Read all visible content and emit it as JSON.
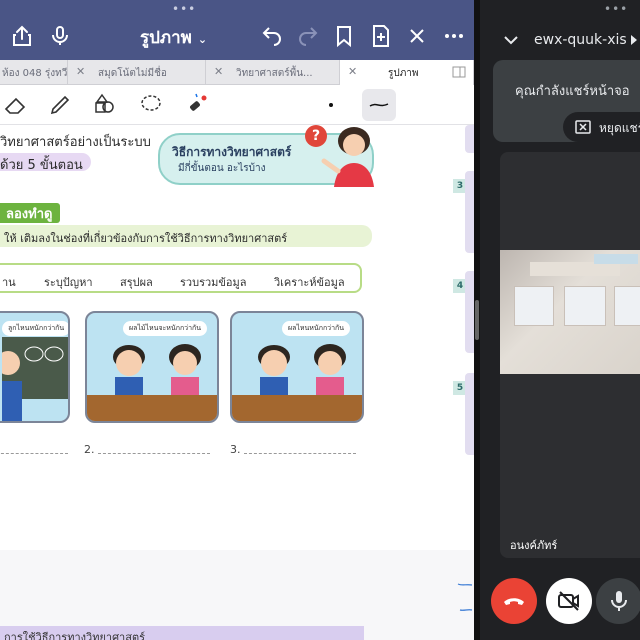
{
  "colors": {
    "titlebar": "#4a5586",
    "meet_bg": "#202124",
    "end_call": "#ea4335",
    "accent_green": "#6db33f"
  },
  "notes": {
    "title": "รูปภาพ",
    "toolbar_icons": [
      "share-icon",
      "microphone-icon",
      "undo-icon",
      "redo-icon",
      "bookmark-icon",
      "add-page-icon",
      "close-icon",
      "more-icon"
    ],
    "tabs": [
      {
        "label": "ห้อง 048 รุ่งทวี...",
        "active": false
      },
      {
        "label": "สมุดโน้ตไม่มีชื่อ",
        "active": false
      },
      {
        "label": "วิทยาศาสตร์พื้น...",
        "active": false
      },
      {
        "label": "รูปภาพ",
        "active": true
      }
    ],
    "tools": [
      "eraser-icon",
      "highlighter-icon",
      "shapes-icon",
      "lasso-icon",
      "laser-pointer-icon",
      "pen-dot-icon",
      "stroke-style-icon"
    ]
  },
  "page": {
    "line1": "วิทยาศาสตร์อย่างเป็นระบบ",
    "line2": "ด้วย 5 ขั้นตอน",
    "banner_title": "วิธีการทางวิทยาศาสตร์",
    "banner_sub": "มีกี่ขั้นตอน อะไรบ้าง",
    "banner_q": "?",
    "section_label": "ลองทำดู",
    "instruction": "ให้ เติมลงในช่องที่เกี่ยวข้องกับการใช้วิธีการทางวิทยาศาสตร์",
    "word_bank": [
      "าน",
      "ระบุปัญหา",
      "สรุปผล",
      "รวบรวมข้อมูล",
      "วิเคราะห์ข้อมูล"
    ],
    "panels": [
      {
        "bubble": "ลูกไหนหนักกว่ากัน"
      },
      {
        "bubble": "ผลไม้ไหนจะหนักกว่ากัน"
      },
      {
        "bubble": "ผลไหนหนักกว่ากัน"
      }
    ],
    "answers": [
      "2.",
      "3."
    ],
    "side_numbers": [
      "3",
      "4",
      "5"
    ],
    "bottom_heading": "การใช้วิธีการทางวิทยาศาสตร์"
  },
  "meet": {
    "meeting_code": "ewx-quuk-xis",
    "share_message": "คุณกำลังแชร์หน้าจอ",
    "stop_label": "หยุดแชร์",
    "participant_name": "อนงค์ภัทร์",
    "controls": [
      "end-call-icon",
      "camera-off-icon",
      "microphone-icon"
    ]
  }
}
